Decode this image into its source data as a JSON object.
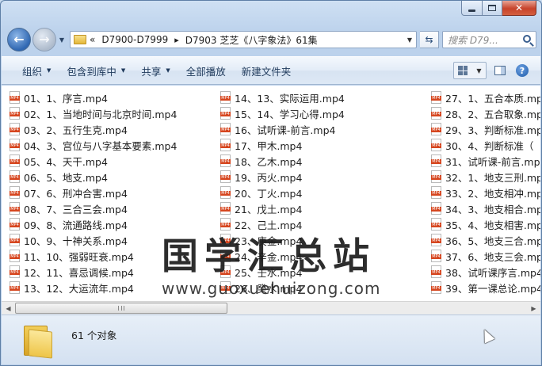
{
  "window": {
    "caption_buttons": {
      "min": "minimize-icon",
      "max": "maximize-icon",
      "close": "✕"
    }
  },
  "address": {
    "chevron": "«",
    "crumbs": [
      "D7900-D7999",
      "D7903 芝芝《八字象法》61集"
    ],
    "separator": "▸",
    "search_placeholder": "搜索 D79..."
  },
  "toolbar": {
    "organize": "组织",
    "include_in_library": "包含到库中",
    "share": "共享",
    "play_all": "全部播放",
    "new_folder": "新建文件夹"
  },
  "files": {
    "col1": [
      "01、1、序言.mp4",
      "02、1、当地时间与北京时间.mp4",
      "03、2、五行生克.mp4",
      "04、3、宫位与八字基本要素.mp4",
      "05、4、天干.mp4",
      "06、5、地支.mp4",
      "07、6、刑冲合害.mp4",
      "08、7、三合三会.mp4",
      "09、8、流通路线.mp4",
      "10、9、十神关系.mp4",
      "11、10、强弱旺衰.mp4",
      "12、11、喜忌调候.mp4",
      "13、12、大运流年.mp4"
    ],
    "col2": [
      "14、13、实际运用.mp4",
      "15、14、学习心得.mp4",
      "16、试听课-前言.mp4",
      "17、甲木.mp4",
      "18、乙木.mp4",
      "19、丙火.mp4",
      "20、丁火.mp4",
      "21、戊土.mp4",
      "22、己土.mp4",
      "23、庚金.mp4",
      "24、辛金.mp4",
      "25、壬水.mp4",
      "26、癸水.mp4"
    ],
    "col3": [
      "27、1、五合本质.mp4",
      "28、2、五合取象.mp4",
      "29、3、判断标准.mp4",
      "30、4、判断标准（",
      "31、试听课-前言.mp4",
      "32、1、地支三刑.mp4",
      "33、2、地支相冲.mp4",
      "34、3、地支相合.mp4",
      "35、4、地支相害.mp4",
      "36、5、地支三合.mp4",
      "37、6、地支三会.mp4",
      "38、试听课序言.mp4",
      "39、第一课总论.mp4"
    ]
  },
  "watermark": {
    "title": "国学汇总站",
    "url": "www.guoxuehuizong.com"
  },
  "details": {
    "count": "61 个对象"
  }
}
